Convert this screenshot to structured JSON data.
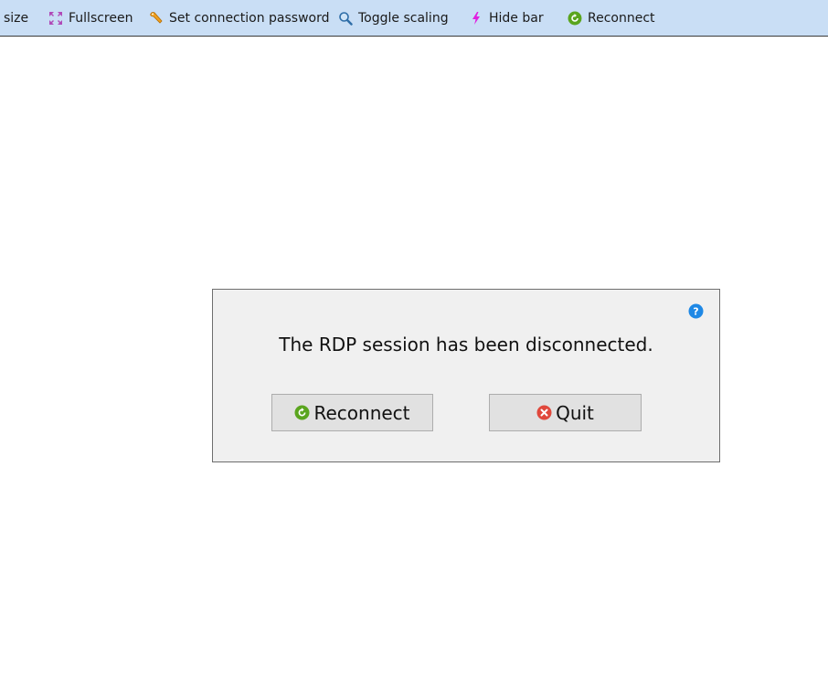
{
  "toolbar": {
    "items": [
      {
        "label": "size",
        "icon": "none"
      },
      {
        "label": "Fullscreen",
        "icon": "fullscreen-icon"
      },
      {
        "label": "Set connection password",
        "icon": "wrench-icon"
      },
      {
        "label": "Toggle scaling",
        "icon": "magnifier-icon"
      },
      {
        "label": "Hide bar",
        "icon": "lightning-icon"
      },
      {
        "label": "Reconnect",
        "icon": "refresh-icon"
      }
    ]
  },
  "dialog": {
    "message": "The RDP session has been disconnected.",
    "help_icon": "question-icon",
    "reconnect_label": "Reconnect",
    "quit_label": "Quit"
  },
  "colors": {
    "toolbar_bg": "#c9def5",
    "dialog_bg": "#f0f0f0",
    "button_bg": "#e1e1e1",
    "reconnect_green": "#5aa51e",
    "quit_red": "#e0483c",
    "help_blue": "#1e88e5"
  }
}
